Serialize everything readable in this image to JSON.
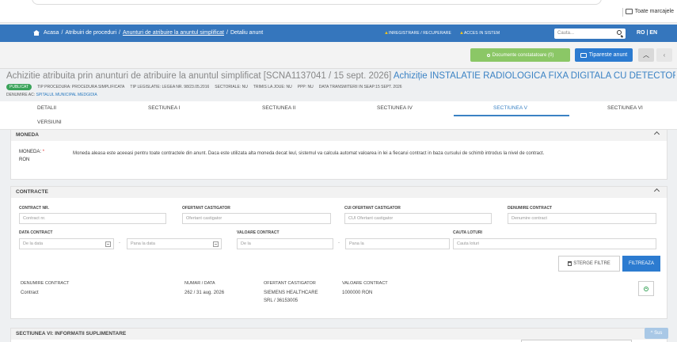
{
  "browser": {
    "bookmarks_label": "Toate marcajele"
  },
  "nav": {
    "home": "Acasa",
    "crumb1": "Atribuiri de proceduri",
    "crumb2": "Anunturi de atribuire la anuntul simplificat",
    "crumb3": "Detaliu anunt",
    "register": "INREGISTRARE / RECUPERARE",
    "access": "ACCES IN SISTEM",
    "search_placeholder": "Cauta...",
    "lang": "RO | EN"
  },
  "toolbar": {
    "documents": "Documente constatatoare (0)",
    "print": "Tipareste anunt"
  },
  "header": {
    "title_prefix": "Achizitie atribuita prin anunturi de atribuire la anuntul simplificat [SCNA1137041 / 15 sept. 2026]",
    "title_highlight": "Achiziție INSTALATIE RADIOLOGICA FIXA DIGITALA CU DETECTORI DI...",
    "badge": "PUBLICAT",
    "tip_procedura": "TIP PROCEDURA: PROCEDURA SIMPLIFICATA",
    "tip_legislatie": "TIP LEGISLATIE: LEGEA NR. 98/23.05.2016",
    "sectoriale": "SECTORIALE: NU",
    "trimis_joue": "TRIMIS LA JOUE: NU",
    "ppp": "PPP: NU",
    "data_transmiterii": "DATA TRANSMITERII IN SEAP:15 SEPT. 2026",
    "denumire_ac_label": "DENUMIRE AC:",
    "denumire_ac_value": "SPITALUL MUNICIPAL MEDGIDIA"
  },
  "tabs": {
    "detalii": "DETALII",
    "s1": "SECTIUNEA I",
    "s2": "SECTIUNEA II",
    "s4": "SECTIUNEA IV",
    "s5": "SECTIUNEA V",
    "s6": "SECTIUNEA VI",
    "versiuni": "VERSIUNI"
  },
  "moneda": {
    "heading": "MONEDA",
    "label": "MONEDA:",
    "required": "*",
    "value": "RON",
    "description": "Moneda aleasa este aceeasi pentru toate contractele din anunt. Daca este utilizata alta moneda decat leul, sistemul va calcula automat valoarea in lei a fiecarui contract in baza cursului de schimb introdus la nivel de contract."
  },
  "contracte": {
    "heading": "CONTRACTE",
    "filters": {
      "contract_nr_label": "CONTRACT NR.",
      "contract_nr_placeholder": "Contract nr.",
      "ofertant_label": "OFERTANT CASTIGATOR",
      "ofertant_placeholder": "Ofertant castigator",
      "cui_label": "CUI OFERTANT CASTIGATOR",
      "cui_placeholder": "CUI Ofertant castigator",
      "denumire_label": "DENUMIRE CONTRACT",
      "denumire_placeholder": "Denumire contract",
      "data_label": "DATA CONTRACT",
      "data_from": "De la data",
      "data_to": "Pana la data",
      "valoare_label": "VALOARE CONTRACT",
      "valoare_from": "De la",
      "valoare_to": "Pana la",
      "loturi_label": "CAUTA LOTURI",
      "loturi_placeholder": "Cauta loturi",
      "dash": "-",
      "clear": "STERGE FILTRE",
      "filter": "FILTREAZA"
    },
    "table": {
      "headers": [
        "DENUMIRE CONTRACT",
        "NUMAR / DATA",
        "OFERTANT CASTIGATOR",
        "VALOARE CONTRACT"
      ],
      "rows": [
        {
          "denumire": "Contract",
          "numar_data": "262 / 31 aug. 2026",
          "ofertant_line1": "SIEMENS HEALTHCARE",
          "ofertant_line2": "SRL / 36153005",
          "valoare": "1000000 RON"
        }
      ]
    }
  },
  "sectiunea_vi": {
    "heading": "SECTIUNEA VI: INFORMATII SUPLIMENTARE"
  },
  "scroll_top": "Sus",
  "colors": {
    "navbar": "#3576bd",
    "accent": "#3a82c4",
    "green": "#8bc766",
    "primary_button": "#2c7bd0",
    "badge": "#3aa35a"
  }
}
